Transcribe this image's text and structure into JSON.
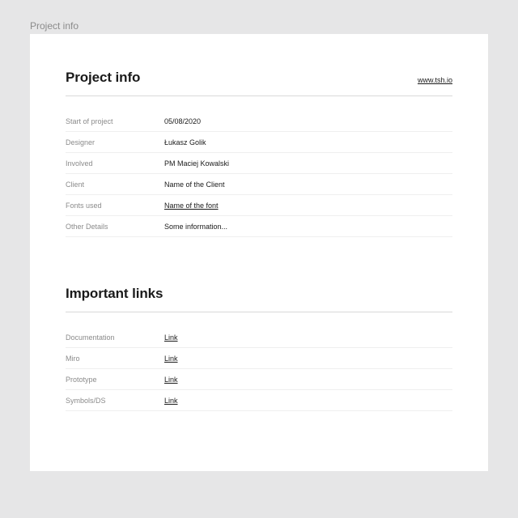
{
  "outer_label": "Project info",
  "section1": {
    "title": "Project info",
    "header_link": "www.tsh.io",
    "rows": [
      {
        "label": "Start of project",
        "value": "05/08/2020",
        "link": false
      },
      {
        "label": "Designer",
        "value": "Łukasz Golik",
        "link": false
      },
      {
        "label": "Involved",
        "value": "PM Maciej Kowalski",
        "link": false
      },
      {
        "label": "Client",
        "value": "Name of the Client",
        "link": false
      },
      {
        "label": "Fonts used",
        "value": "Name of the font",
        "link": true
      },
      {
        "label": "Other Details",
        "value": "Some information...",
        "link": false
      }
    ]
  },
  "section2": {
    "title": "Important links",
    "rows": [
      {
        "label": "Documentation",
        "value": "Link",
        "link": true
      },
      {
        "label": "Miro",
        "value": "Link",
        "link": true
      },
      {
        "label": "Prototype",
        "value": "Link",
        "link": true
      },
      {
        "label": "Symbols/DS",
        "value": "Link",
        "link": true
      }
    ]
  }
}
